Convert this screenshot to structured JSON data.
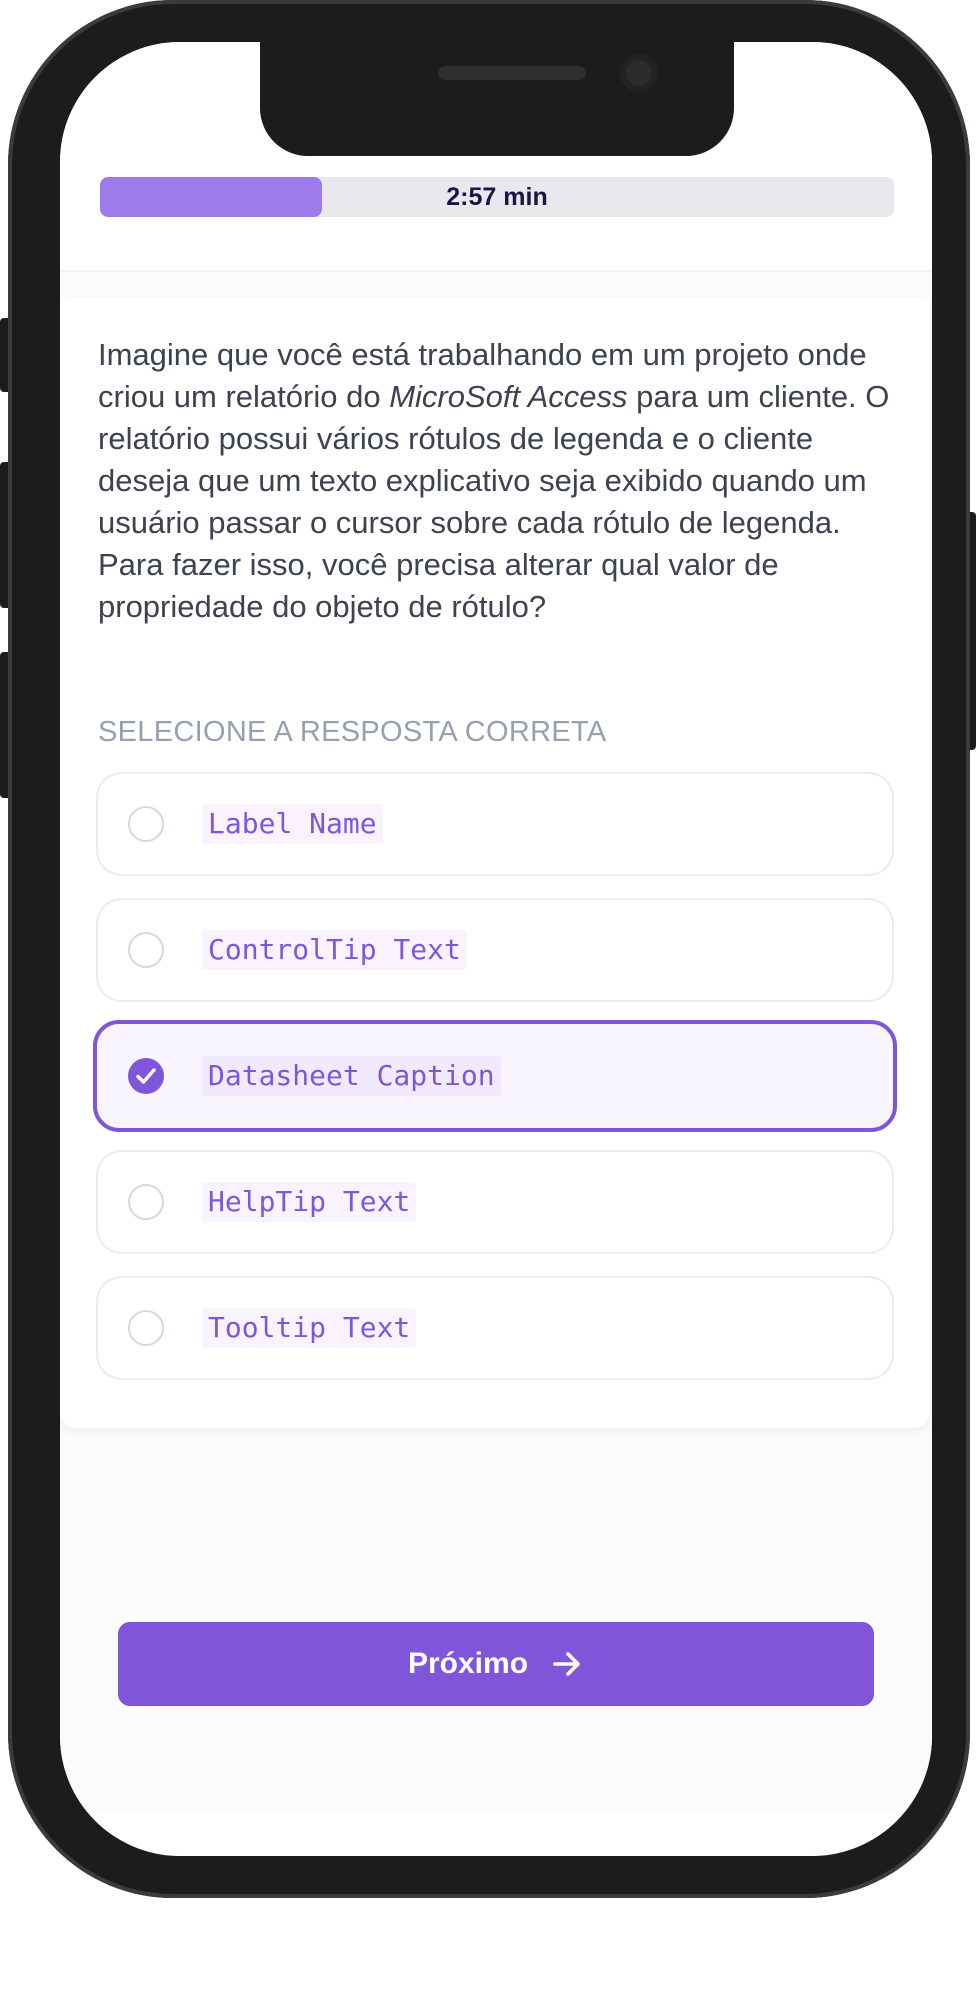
{
  "timer": {
    "label": "2:57 min",
    "progress_fraction": 0.28
  },
  "question": {
    "text_before": "Imagine que você está trabalhando em um projeto onde criou um relatório do ",
    "emphasis": "MicroSoft Access",
    "text_after": " para um cliente. O relatório possui vários rótulos de legenda e o cliente deseja que um texto explicativo seja exibido quando um usuário passar o cursor sobre cada rótulo de legenda. Para fazer isso, você precisa alterar qual valor de propriedade do objeto de rótulo?"
  },
  "answers": {
    "heading": "SELECIONE A RESPOSTA CORRETA",
    "options": [
      {
        "label": "Label Name",
        "selected": false
      },
      {
        "label": "ControlTip Text",
        "selected": false
      },
      {
        "label": "Datasheet Caption",
        "selected": true
      },
      {
        "label": "HelpTip Text",
        "selected": false
      },
      {
        "label": "Tooltip Text",
        "selected": false
      }
    ]
  },
  "footer": {
    "next_label": "Próximo",
    "next_icon": "arrow-right-icon"
  },
  "colors": {
    "accent": "#7f56d9",
    "progress": "#9f7aea",
    "track": "#e9e9ed"
  }
}
